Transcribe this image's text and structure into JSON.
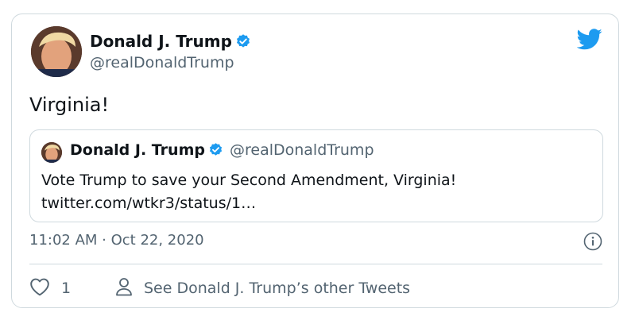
{
  "author": {
    "name": "Donald J. Trump",
    "handle": "@realDonaldTrump"
  },
  "tweet": {
    "text": "Virginia!",
    "timestamp": "11:02 AM · Oct 22, 2020"
  },
  "quoted_tweet": {
    "name": "Donald J. Trump",
    "handle": "@realDonaldTrump",
    "text_line1": "Vote Trump to save your Second Amendment, Virginia!",
    "text_line2": "twitter.com/wtkr3/status/1…"
  },
  "actions": {
    "like_count": "1",
    "profile_link": "See Donald J. Trump’s other Tweets"
  },
  "colors": {
    "twitter_blue": "#1d9bf0",
    "secondary_text": "#536471",
    "border": "#cfd9de"
  },
  "icons": [
    "twitter-bird-icon",
    "verified-badge-icon",
    "info-icon",
    "heart-icon",
    "person-icon"
  ]
}
